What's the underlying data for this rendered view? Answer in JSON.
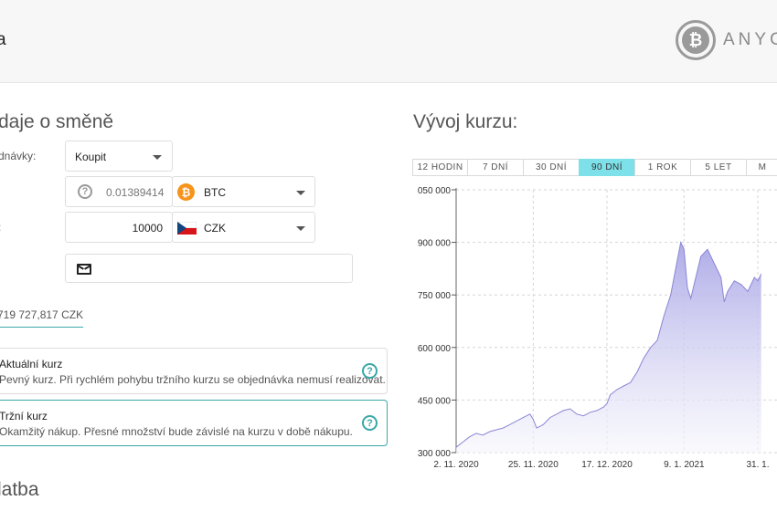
{
  "header": {
    "title_fragment": "a",
    "logo_text": "ANYC",
    "logo_glyph": "₿"
  },
  "exchange": {
    "title": "daje o směně",
    "order_type_label": "dnávky:",
    "order_type_value": "Koupit",
    "amount_label": ":",
    "crypto_amount": "0.01389414",
    "crypto_currency": "BTC",
    "fiat_amount": "10000",
    "fiat_currency": "CZK",
    "rate_text": "719 727,817 CZK",
    "options": [
      {
        "title": "Aktuální kurz",
        "desc": "Pevný kurz. Při rychlém pohybu tržního kurzu se objednávka nemusí realizovat."
      },
      {
        "title": "Tržní kurz",
        "desc": "Okamžitý nákup. Přesné množství bude závislé na kurzu v době nákupu."
      }
    ],
    "payment_title": "latba"
  },
  "chart_panel": {
    "title": "Vývoj kurzu:",
    "tabs": [
      "12 HODIN",
      "7 DNÍ",
      "30 DNÍ",
      "90 DNÍ",
      "1 ROK",
      "5 LET",
      "M"
    ],
    "active_tab": "90 DNÍ"
  },
  "chart_data": {
    "type": "area",
    "title": "",
    "xlabel": "",
    "ylabel": "",
    "ylim": [
      300000,
      1050000
    ],
    "y_ticks": [
      "050 000",
      "900 000",
      "750 000",
      "600 000",
      "450 000",
      "300 000"
    ],
    "x_ticks": [
      "2. 11. 2020",
      "25. 11. 2020",
      "17. 12. 2020",
      "9. 1. 2021",
      "31. 1."
    ],
    "grid": true,
    "colors": {
      "line": "#8a86d6",
      "fill_top": "#aaa7e6",
      "fill_bottom": "#f5f5fc"
    },
    "x": [
      "2020-11-02",
      "2020-11-04",
      "2020-11-06",
      "2020-11-08",
      "2020-11-10",
      "2020-11-12",
      "2020-11-14",
      "2020-11-16",
      "2020-11-18",
      "2020-11-20",
      "2020-11-22",
      "2020-11-24",
      "2020-11-25",
      "2020-11-26",
      "2020-11-28",
      "2020-11-30",
      "2020-12-02",
      "2020-12-04",
      "2020-12-06",
      "2020-12-08",
      "2020-12-10",
      "2020-12-12",
      "2020-12-14",
      "2020-12-16",
      "2020-12-17",
      "2020-12-18",
      "2020-12-20",
      "2020-12-22",
      "2020-12-24",
      "2020-12-26",
      "2020-12-28",
      "2020-12-30",
      "2021-01-01",
      "2021-01-03",
      "2021-01-05",
      "2021-01-07",
      "2021-01-08",
      "2021-01-09",
      "2021-01-10",
      "2021-01-11",
      "2021-01-12",
      "2021-01-14",
      "2021-01-16",
      "2021-01-18",
      "2021-01-20",
      "2021-01-21",
      "2021-01-22",
      "2021-01-24",
      "2021-01-26",
      "2021-01-28",
      "2021-01-30",
      "2021-01-31",
      "2021-02-01"
    ],
    "series": [
      {
        "values": [
          315000,
          330000,
          345000,
          355000,
          350000,
          360000,
          365000,
          370000,
          380000,
          390000,
          400000,
          410000,
          395000,
          370000,
          380000,
          400000,
          410000,
          420000,
          425000,
          410000,
          405000,
          415000,
          420000,
          430000,
          440000,
          465000,
          480000,
          490000,
          500000,
          530000,
          570000,
          600000,
          620000,
          690000,
          750000,
          850000,
          900000,
          880000,
          770000,
          740000,
          780000,
          860000,
          880000,
          840000,
          800000,
          730000,
          760000,
          790000,
          780000,
          760000,
          800000,
          790000,
          810000
        ]
      }
    ]
  }
}
